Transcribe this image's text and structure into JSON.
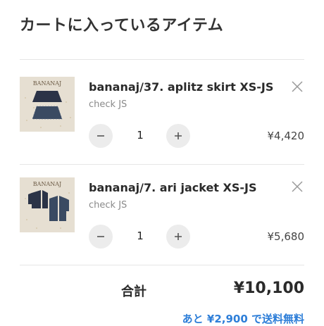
{
  "page": {
    "title": "カートに入っているアイテム"
  },
  "cart": {
    "items": [
      {
        "name": "bananaj/37. aplitz skirt XS-JS",
        "variant": "check JS",
        "quantity": "1",
        "price": "¥4,420",
        "thumb_brand": "BANANAJ",
        "thumb_icon": "skirt-product-image"
      },
      {
        "name": "bananaj/7. ari jacket XS-JS",
        "variant": "check JS",
        "quantity": "1",
        "price": "¥5,680",
        "thumb_brand": "BANANAJ",
        "thumb_icon": "jacket-product-image"
      }
    ],
    "total_label": "合計",
    "total_value": "¥10,100",
    "free_shipping_note": "あと ¥2,900 で送料無料"
  },
  "colors": {
    "accent": "#2d7ed8",
    "text": "#2a2a2a",
    "muted": "#8a8a8a",
    "qty_bg": "#ececec",
    "divider": "#e6e6e6"
  }
}
